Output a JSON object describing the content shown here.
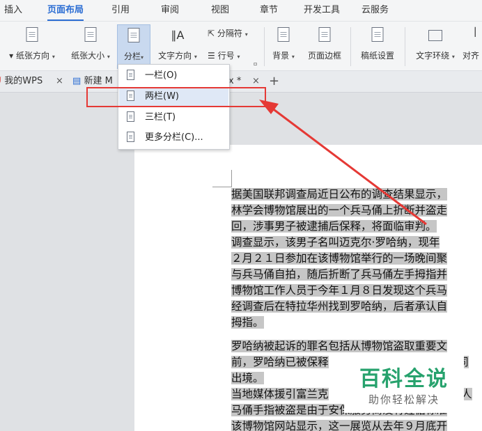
{
  "menu_tabs": [
    "插入",
    "页面布局",
    "引用",
    "审阅",
    "视图",
    "章节",
    "开发工具",
    "云服务"
  ],
  "ribbon": {
    "orientation_label": "纸张方向",
    "size_label": "纸张大小",
    "columns_label": "分栏",
    "text_direction_label": "文字方向",
    "separator_label": "分隔符",
    "line_number_label": "行号",
    "background_label": "背景",
    "page_border_label": "页面边框",
    "manuscript_label": "稿纸设置",
    "text_wrap_label": "文字环绕",
    "align_label": "对齐"
  },
  "doc_tabs": {
    "tab1": "我的WPS",
    "tab2": "新建 M",
    "tab3_suffix": "x *",
    "close": "×",
    "add": "+"
  },
  "columns_menu": {
    "items": [
      "一栏(O)",
      "两栏(W)",
      "三栏(T)",
      "更多分栏(C)..."
    ],
    "highlighted": "两栏(W)"
  },
  "document_lines": [
    "据美国联邦调查局近日公布的调查结果显示，",
    "林学会博物馆展出的一个兵马俑上折断并盗走",
    "回，涉事男子被逮捕后保释，将面临审判。",
    "调查显示，该男子名叫迈克尔·罗哈纳，现年",
    "２月２１日参加在该博物馆举行的一场晚间聚",
    "与兵马俑自拍，随后折断了兵马俑左手拇指并",
    "博物馆工作人员于今年１月８日发现这个兵马",
    "经调查后在特拉华州找到罗哈纳，后者承认自",
    "拇指。",
    "罗哈纳被起诉的罪名包括从博物馆盗取重要文",
    "前，罗哈纳已被保释",
    "出境。",
    "当地媒体援引富兰克",
    "马俑手指被盗是由于安保服务商没有遵循标准",
    "该博物馆网站显示，这一展览从去年９月底开"
  ],
  "line10_tail": "、同",
  "line12_tail": "言人",
  "watermark": {
    "title": "百科全说",
    "subtitle": "助你轻松解决"
  },
  "colors": {
    "accent": "#2b6dd3",
    "annotation_red": "#e53935",
    "watermark_green": "#27a26d",
    "text_highlight": "#c6c6c6"
  }
}
